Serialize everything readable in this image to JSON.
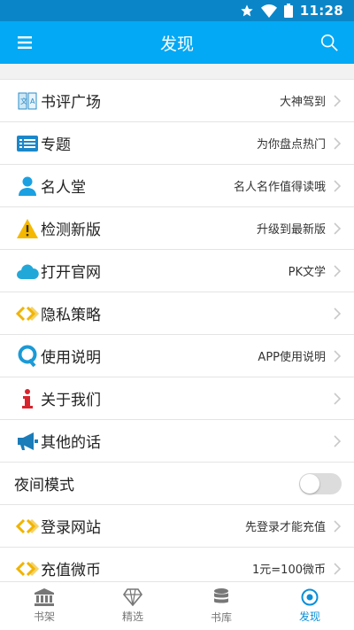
{
  "status": {
    "time": "11:28"
  },
  "appbar": {
    "title": "发现",
    "menu_icon": "menu-icon",
    "search_icon": "search-icon"
  },
  "items": [
    {
      "label": "书评广场",
      "value": "大神驾到",
      "icon": "book-review-icon"
    },
    {
      "label": "专题",
      "value": "为你盘点热门",
      "icon": "list-card-icon"
    },
    {
      "label": "名人堂",
      "value": "名人名作值得读哦",
      "icon": "person-icon"
    },
    {
      "label": "检测新版",
      "value": "升级到最新版",
      "icon": "warning-icon"
    },
    {
      "label": "打开官网",
      "value": "PK文学",
      "icon": "cloud-icon"
    },
    {
      "label": "隐私策略",
      "value": "",
      "icon": "link-chain-icon"
    },
    {
      "label": "使用说明",
      "value": "APP使用说明",
      "icon": "q-letter-icon"
    },
    {
      "label": "关于我们",
      "value": "",
      "icon": "info-icon"
    },
    {
      "label": "其他的话",
      "value": "",
      "icon": "megaphone-icon"
    }
  ],
  "night_mode": {
    "label": "夜间模式",
    "enabled": false
  },
  "items2": [
    {
      "label": "登录网站",
      "value": "先登录才能充值",
      "icon": "link-chain-icon"
    },
    {
      "label": "充值微币",
      "value": "1元=100微币",
      "icon": "link-chain-icon"
    }
  ],
  "tabs": [
    {
      "label": "书架",
      "icon": "bank-icon",
      "active": false
    },
    {
      "label": "精选",
      "icon": "diamond-icon",
      "active": false
    },
    {
      "label": "书库",
      "icon": "database-icon",
      "active": false
    },
    {
      "label": "发现",
      "icon": "target-icon",
      "active": true
    }
  ],
  "colors": {
    "status_bar": "#0a86c8",
    "app_bar": "#03a9f4",
    "accent": "#0a8fd8",
    "link_icon": "#f0b400"
  }
}
